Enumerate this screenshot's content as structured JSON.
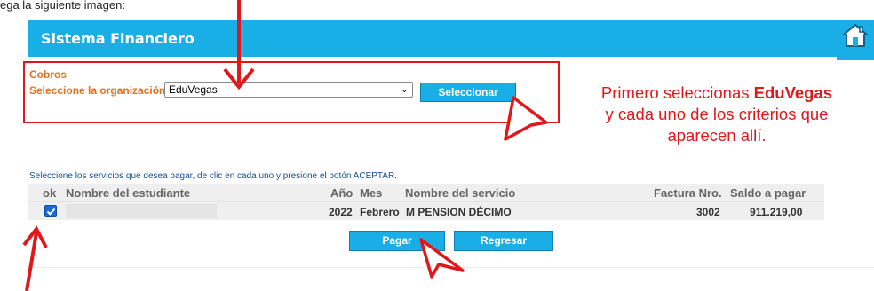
{
  "top_text": "ega la siguiente imagen:",
  "header": {
    "title": "Sistema Financiero",
    "home_icon": "home-icon"
  },
  "form": {
    "section_label": "Cobros",
    "org_label": "Seleccione la organización:",
    "org_selected": "EduVegas",
    "select_button": "Seleccionar"
  },
  "annotation": {
    "line1_prefix": "Primero seleccionas ",
    "line1_bold": "EduVegas",
    "line2": "y cada uno de los criterios que",
    "line3": "aparecen allí."
  },
  "instructions": "Seleccione los servicios que desea pagar, de clic en cada uno y presione el botón ACEPTAR.",
  "table": {
    "headers": {
      "ok": "ok",
      "student": "Nombre del estudiante",
      "year": "Año",
      "month": "Mes",
      "service": "Nombre del servicio",
      "invoice": "Factura Nro.",
      "balance": "Saldo a pagar"
    },
    "rows": [
      {
        "checked": true,
        "year": "2022",
        "month": "Febrero",
        "service": "M PENSION DÉCIMO",
        "invoice": "3002",
        "balance": "911.219,00"
      }
    ]
  },
  "actions": {
    "pay": "Pagar",
    "back": "Regresar"
  },
  "colors": {
    "header_blue": "#1aaee6",
    "annotation_red": "#e0181b",
    "label_orange": "#e8701a",
    "instruction_blue": "#1a4f8a"
  }
}
